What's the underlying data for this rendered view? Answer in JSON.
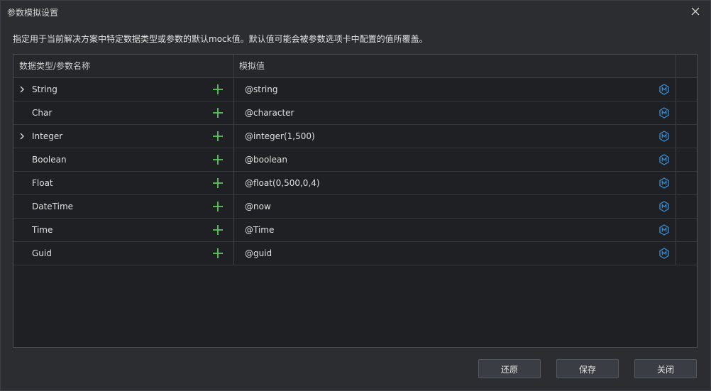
{
  "window": {
    "title": "参数模拟设置",
    "close_icon": "close-icon"
  },
  "description": "指定用于当前解决方案中特定数据类型或参数的默认mock值。默认值可能会被参数选项卡中配置的值所覆盖。",
  "table": {
    "columns": [
      "数据类型/参数名称",
      "模拟值"
    ],
    "rows": [
      {
        "name": "String",
        "value": "@string",
        "expandable": true
      },
      {
        "name": "Char",
        "value": "@character",
        "expandable": false
      },
      {
        "name": "Integer",
        "value": "@integer(1,500)",
        "expandable": true
      },
      {
        "name": "Boolean",
        "value": "@boolean",
        "expandable": false
      },
      {
        "name": "Float",
        "value": "@float(0,500,0,4)",
        "expandable": false
      },
      {
        "name": "DateTime",
        "value": "@now",
        "expandable": false
      },
      {
        "name": "Time",
        "value": "@Time",
        "expandable": false
      },
      {
        "name": "Guid",
        "value": "@guid",
        "expandable": false
      }
    ]
  },
  "buttons": {
    "restore": "还原",
    "save": "保存",
    "close": "关闭"
  },
  "colors": {
    "add_icon": "#5fc95f",
    "mock_icon": "#3a8fd8"
  }
}
